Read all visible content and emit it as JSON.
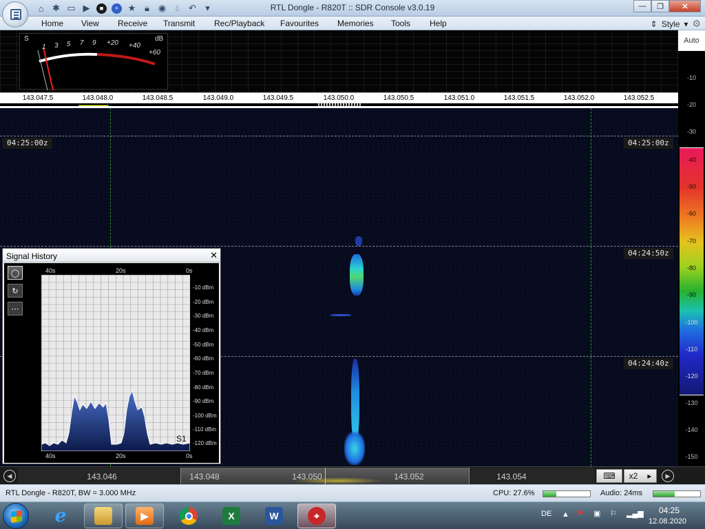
{
  "window": {
    "title": "RTL Dongle - R820T :: SDR Console v3.0.19",
    "minimize": "—",
    "maximize": "❐",
    "close": "✕"
  },
  "menu": {
    "items": [
      "Home",
      "View",
      "Receive",
      "Transmit",
      "Rec/Playback",
      "Favourites",
      "Memories",
      "Tools",
      "Help"
    ],
    "style_label": "Style"
  },
  "smeter": {
    "s_label": "S",
    "db_label": "dB",
    "scale": [
      "1",
      "3",
      "5",
      "7",
      "9",
      "+20",
      "+40",
      "+60"
    ],
    "reading": "S1"
  },
  "spectrum": {
    "freq_labels": [
      "143.047.5",
      "143.048.0",
      "143.048.5",
      "143.049.0",
      "143.049.5",
      "143.050.0",
      "143.050.5",
      "143.051.0",
      "143.051.5",
      "143.052.0",
      "143.052.5"
    ]
  },
  "waterfall": {
    "timestamps": [
      "04:25:00z",
      "04:24:50z",
      "04:24:40z"
    ]
  },
  "db_scale": {
    "auto_label": "Auto",
    "upper": [
      "-10",
      "-20",
      "-30"
    ],
    "colorbar": [
      "-40",
      "-50",
      "-60",
      "-70",
      "-80",
      "-90",
      "-100",
      "-110",
      "-120"
    ],
    "lower": [
      "-130",
      "-140",
      "-150"
    ]
  },
  "signal_history": {
    "title": "Signal History",
    "close": "✕",
    "tools": [
      "◯",
      "↻",
      "⋯"
    ],
    "top_time_labels": [
      "40s",
      "20s",
      "0s"
    ],
    "bottom_time_labels": [
      "40s",
      "20s",
      "0s"
    ],
    "dbm_labels": [
      "-10 dBm",
      "-20 dBm",
      "-30 dBm",
      "-40 dBm",
      "-50 dBm",
      "-60 dBm",
      "-70 dBm",
      "-80 dBm",
      "-90 dBm",
      "-100 dBm",
      "-110 dBm",
      "-120 dBm"
    ],
    "s_reading": "S1"
  },
  "tuning": {
    "labels": [
      "143.046",
      "143.048",
      "143.050",
      "143.052",
      "143.054"
    ],
    "zoom_label": "x2",
    "keyboard_icon": "⌨",
    "zoom_arrow": "▸",
    "prev_icon": "◀",
    "next_icon": "▶"
  },
  "status": {
    "device": "RTL Dongle - R820T, BW = 3.000 MHz",
    "cpu": "CPU: 27.6%",
    "cpu_fraction": 0.276,
    "audio": "Audio: 24ms",
    "audio_fraction": 0.45
  },
  "taskbar": {
    "lang": "DE",
    "time": "04:25",
    "date": "12.08.2020",
    "apps": [
      "internet-explorer",
      "file-explorer",
      "media-player",
      "chrome",
      "excel",
      "word",
      "sdr-console"
    ]
  }
}
